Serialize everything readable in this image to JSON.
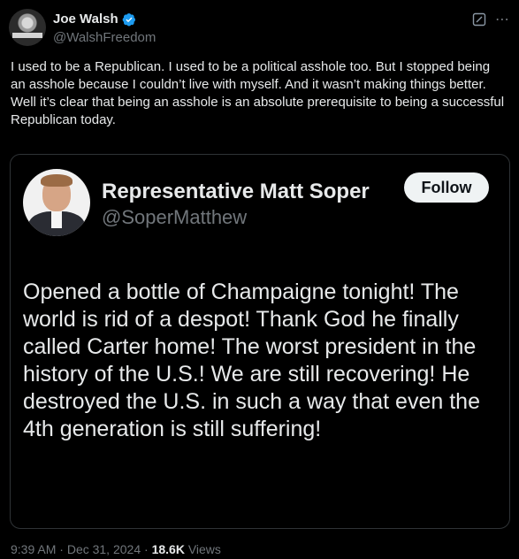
{
  "author": {
    "name": "Joe Walsh",
    "handle": "@WalshFreedom"
  },
  "tweet": {
    "text": "I used to be a Republican. I used to be a political asshole too. But I stopped being an asshole because I couldn’t live with myself. And it wasn’t making things better. Well it’s clear that being an asshole is an absolute prerequisite to being a successful Republican today."
  },
  "quoted": {
    "name": "Representative Matt Soper",
    "handle": "@SoperMatthew",
    "follow_label": "Follow",
    "text": "Opened a bottle of Champaigne tonight! The world is rid of a despot! Thank God he finally called Carter home! The worst president in the history of the U.S.! We are still recovering! He destroyed the U.S. in such a way that even the 4th generation is still suffering!"
  },
  "meta": {
    "time": "9:39 AM",
    "date": "Dec 31, 2024",
    "views_count": "18.6K",
    "views_label": "Views",
    "sep": "·"
  },
  "icons": {
    "verified": "verified-badge-icon",
    "grok": "grok-icon",
    "more": "more-icon"
  },
  "colors": {
    "verified": "#1d9bf0",
    "muted": "#71767b",
    "text": "#e7e9ea"
  }
}
